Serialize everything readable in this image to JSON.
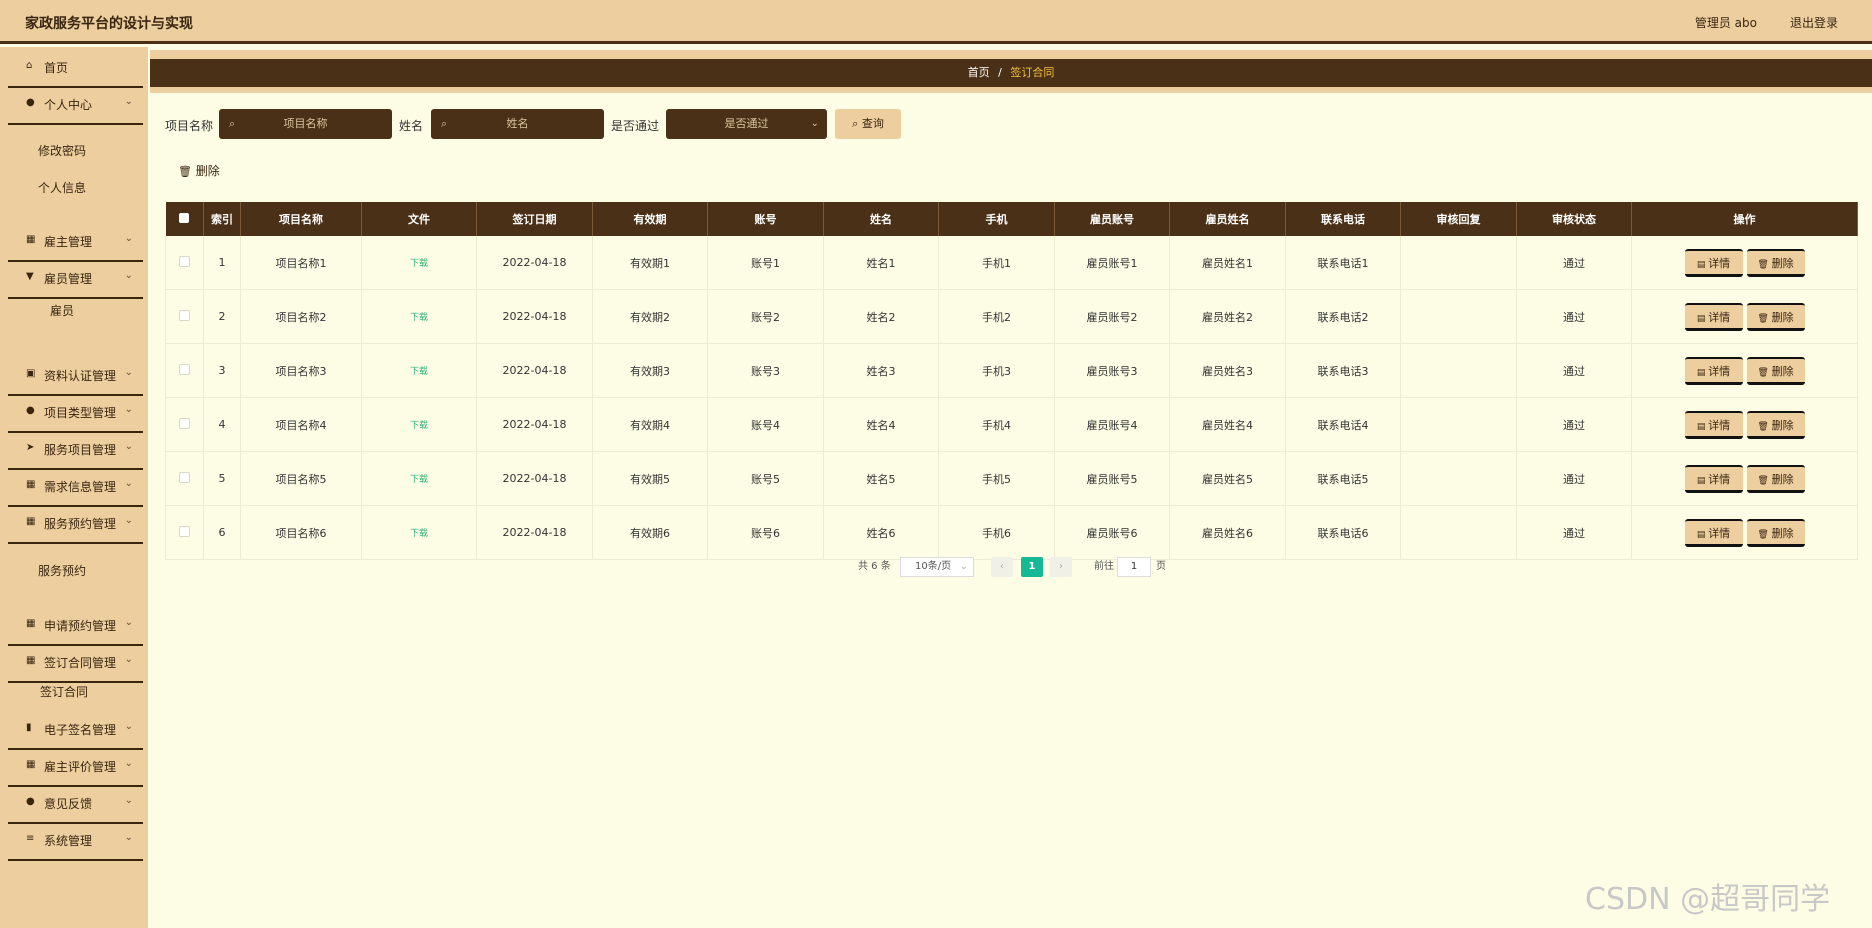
{
  "header": {
    "title": "家政服务平台的设计与实现",
    "user": "管理员 abo",
    "logout": "退出登录"
  },
  "sidebar": {
    "items": [
      {
        "label": "首页",
        "icon": "home-icon"
      },
      {
        "label": "个人中心",
        "icon": "user-icon"
      },
      {
        "label": "雇主管理",
        "icon": "grid-icon"
      },
      {
        "label": "雇员管理",
        "icon": "badge-icon"
      },
      {
        "label": "资料认证管理",
        "icon": "clipboard-icon"
      },
      {
        "label": "项目类型管理",
        "icon": "user-icon"
      },
      {
        "label": "服务项目管理",
        "icon": "send-icon"
      },
      {
        "label": "需求信息管理",
        "icon": "grid-icon"
      },
      {
        "label": "服务预约管理",
        "icon": "grid-icon"
      },
      {
        "label": "申请预约管理",
        "icon": "grid-icon"
      },
      {
        "label": "签订合同管理",
        "icon": "grid-icon"
      },
      {
        "label": "电子签名管理",
        "icon": "chart-icon"
      },
      {
        "label": "雇主评价管理",
        "icon": "grid-icon"
      },
      {
        "label": "意见反馈",
        "icon": "user-icon"
      },
      {
        "label": "系统管理",
        "icon": "menu-icon"
      }
    ],
    "sub": {
      "change_password": "修改密码",
      "profile": "个人信息",
      "employee": "雇员",
      "service_booking": "服务预约",
      "sign_contract": "签订合同"
    }
  },
  "breadcrumb": {
    "home": "首页",
    "sep": "/",
    "current": "签订合同"
  },
  "search": {
    "project_label": "项目名称",
    "project_placeholder": "项目名称",
    "name_label": "姓名",
    "name_placeholder": "姓名",
    "passed_label": "是否通过",
    "passed_placeholder": "是否通过",
    "query_button": "查询"
  },
  "toolbar": {
    "delete_label": "删除"
  },
  "table": {
    "headers": [
      "索引",
      "项目名称",
      "文件",
      "签订日期",
      "有效期",
      "账号",
      "姓名",
      "手机",
      "雇员账号",
      "雇员姓名",
      "联系电话",
      "审核回复",
      "审核状态",
      "操作"
    ],
    "rows": [
      {
        "idx": "1",
        "project": "项目名称1",
        "file": "下载",
        "date": "2022-04-18",
        "validity": "有效期1",
        "account": "账号1",
        "name": "姓名1",
        "phone": "手机1",
        "emp_account": "雇员账号1",
        "emp_name": "雇员姓名1",
        "contact": "联系电话1",
        "reply": "",
        "status": "通过"
      },
      {
        "idx": "2",
        "project": "项目名称2",
        "file": "下载",
        "date": "2022-04-18",
        "validity": "有效期2",
        "account": "账号2",
        "name": "姓名2",
        "phone": "手机2",
        "emp_account": "雇员账号2",
        "emp_name": "雇员姓名2",
        "contact": "联系电话2",
        "reply": "",
        "status": "通过"
      },
      {
        "idx": "3",
        "project": "项目名称3",
        "file": "下载",
        "date": "2022-04-18",
        "validity": "有效期3",
        "account": "账号3",
        "name": "姓名3",
        "phone": "手机3",
        "emp_account": "雇员账号3",
        "emp_name": "雇员姓名3",
        "contact": "联系电话3",
        "reply": "",
        "status": "通过"
      },
      {
        "idx": "4",
        "project": "项目名称4",
        "file": "下载",
        "date": "2022-04-18",
        "validity": "有效期4",
        "account": "账号4",
        "name": "姓名4",
        "phone": "手机4",
        "emp_account": "雇员账号4",
        "emp_name": "雇员姓名4",
        "contact": "联系电话4",
        "reply": "",
        "status": "通过"
      },
      {
        "idx": "5",
        "project": "项目名称5",
        "file": "下载",
        "date": "2022-04-18",
        "validity": "有效期5",
        "account": "账号5",
        "name": "姓名5",
        "phone": "手机5",
        "emp_account": "雇员账号5",
        "emp_name": "雇员姓名5",
        "contact": "联系电话5",
        "reply": "",
        "status": "通过"
      },
      {
        "idx": "6",
        "project": "项目名称6",
        "file": "下载",
        "date": "2022-04-18",
        "validity": "有效期6",
        "account": "账号6",
        "name": "姓名6",
        "phone": "手机6",
        "emp_account": "雇员账号6",
        "emp_name": "雇员姓名6",
        "contact": "联系电话6",
        "reply": "",
        "status": "通过"
      }
    ],
    "detail_button": "详情",
    "delete_button": "删除"
  },
  "pagination": {
    "total": "共 6 条",
    "page_size": "10条/页",
    "current_page": "1",
    "goto_label": "前往",
    "goto_value": "1",
    "page_suffix": "页"
  },
  "watermark": "CSDN @超哥同学",
  "colors": {
    "dark": "#4a3016",
    "accent": "#ecce9f",
    "background": "#fdfde6",
    "active_page": "#16b896"
  }
}
